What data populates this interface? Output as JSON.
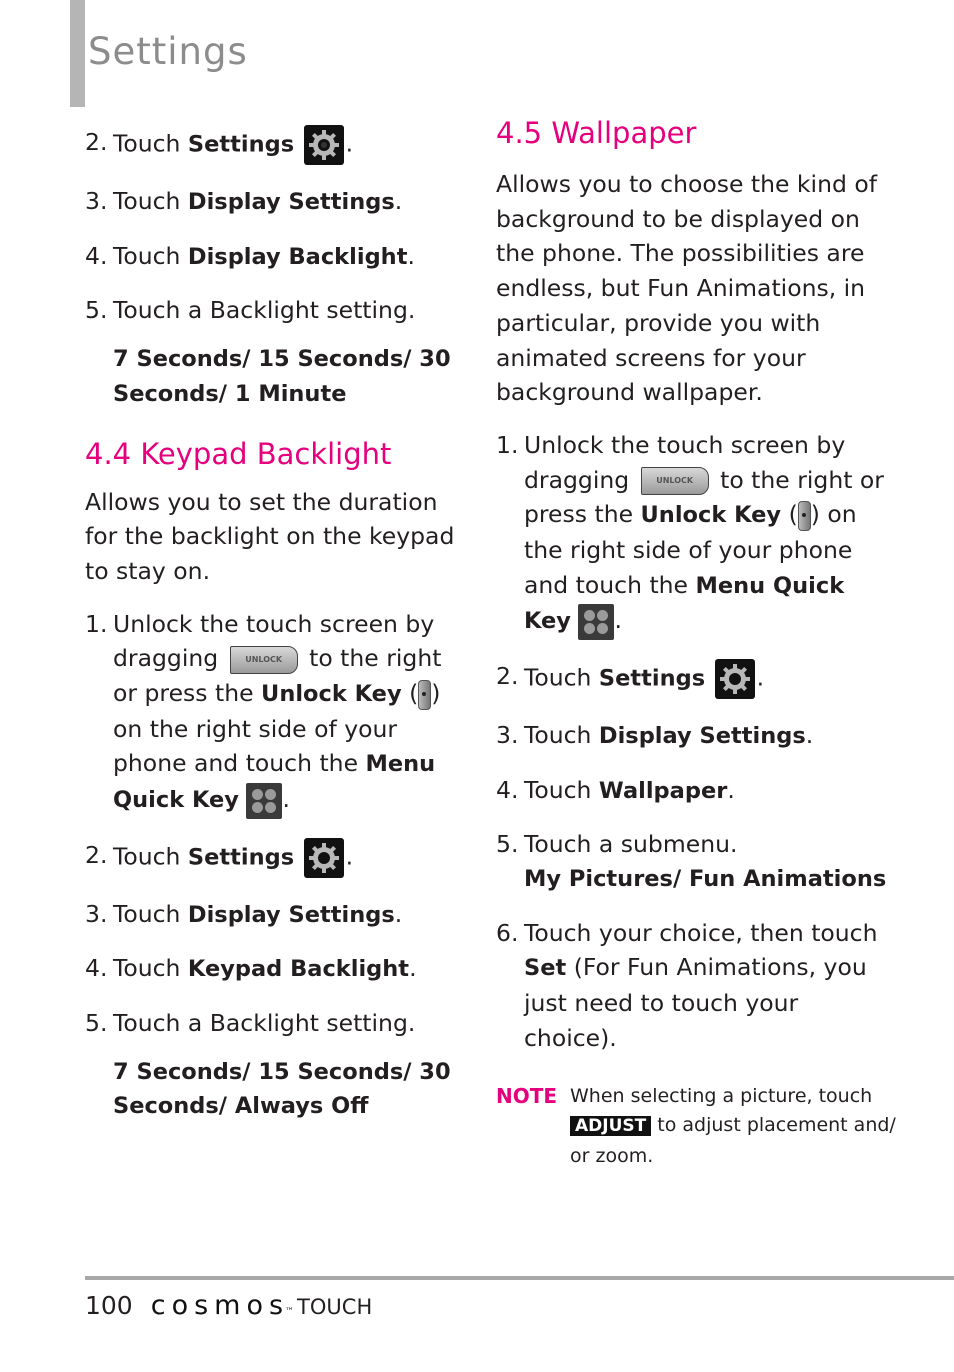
{
  "header": {
    "title": "Settings"
  },
  "left_column": {
    "intro_steps": [
      {
        "num": "2.",
        "pre": "Touch ",
        "key": "Settings",
        "icon": "gear-icon",
        "post": "."
      },
      {
        "num": "3.",
        "pre": "Touch ",
        "key": "Display Settings",
        "post": "."
      },
      {
        "num": "4.",
        "pre": "Touch ",
        "key": "Display Backlight",
        "post": "."
      },
      {
        "num": "5.",
        "pre": "Touch a Backlight setting.",
        "key": "",
        "post": ""
      }
    ],
    "intro_options": "7 Seconds/ 15 Seconds/ 30 Seconds/ 1 Minute",
    "section": {
      "heading": "4.4 Keypad Backlight",
      "description": "Allows you to set the duration for the backlight on the keypad to stay on.",
      "step1": {
        "num": "1.",
        "a": "Unlock the touch screen by dragging",
        "slider_label": "UNLOCK",
        "b": "to the right or press the",
        "unlock_key": "Unlock Key",
        "c": "on the right side of your phone and touch the",
        "menu_key": "Menu Quick Key",
        "d": "."
      },
      "steps": [
        {
          "num": "2.",
          "pre": "Touch ",
          "key": "Settings",
          "post": "."
        },
        {
          "num": "3.",
          "pre": "Touch ",
          "key": "Display Settings",
          "post": "."
        },
        {
          "num": "4.",
          "pre": "Touch ",
          "key": "Keypad Backlight",
          "post": "."
        },
        {
          "num": "5.",
          "pre": "Touch a Backlight setting.",
          "key": "",
          "post": ""
        }
      ],
      "options": "7 Seconds/ 15 Seconds/ 30 Seconds/ Always Off"
    }
  },
  "right_column": {
    "heading": "4.5 Wallpaper",
    "description": "Allows you to choose the kind of background to be displayed on the phone. The possibilities are endless, but Fun Animations, in particular, provide you with animated screens for your background wallpaper.",
    "step1": {
      "num": "1.",
      "a": "Unlock the touch screen by dragging",
      "slider_label": "UNLOCK",
      "b": "to the right or press the",
      "unlock_key": "Unlock Key",
      "c": "on the right side of your phone and touch the",
      "menu_key": "Menu Quick Key",
      "d": "."
    },
    "steps": [
      {
        "num": "2.",
        "pre": "Touch ",
        "key": "Settings",
        "post": "."
      },
      {
        "num": "3.",
        "pre": "Touch ",
        "key": "Display Settings",
        "post": "."
      },
      {
        "num": "4.",
        "pre": "Touch ",
        "key": "Wallpaper",
        "post": "."
      },
      {
        "num": "5.",
        "pre": "Touch a submenu.",
        "key": "",
        "post": ""
      }
    ],
    "submenu_options": "My Pictures/ Fun Animations",
    "step6": {
      "num": "6.",
      "pre": "Touch your choice, then touch ",
      "key": "Set",
      "post": " (For Fun Animations, you just need to touch your choice)."
    },
    "note": {
      "label": "NOTE",
      "a": "When selecting a picture, touch",
      "badge": "ADJUST",
      "b": "to adjust placement and/ or zoom."
    }
  },
  "footer": {
    "page_number": "100",
    "brand": "cosmos",
    "brand_tm": "™",
    "brand_suffix": "TOUCH"
  },
  "colors": {
    "accent": "#e5007e",
    "title_gray": "#8c8c8c",
    "rule_gray": "#a8a8a8"
  }
}
